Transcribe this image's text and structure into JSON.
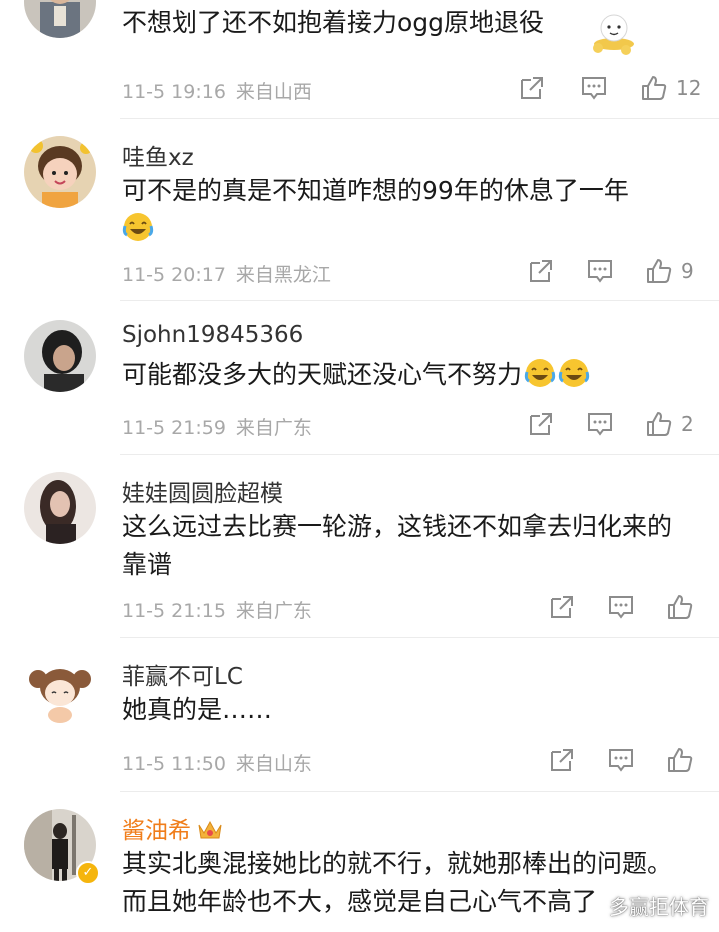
{
  "comments": [
    {
      "username": "",
      "text": "不想划了还不如抱着接力ogg原地退役",
      "time": "11-5 19:16",
      "location": "来自山西",
      "likes": "12",
      "avatar": "man-avatar"
    },
    {
      "username": "哇鱼xz",
      "text": "可不是的真是不知道咋想的99年的休息了一年",
      "time": "11-5 20:17",
      "location": "来自黑龙江",
      "likes": "9",
      "avatar": "cartoon-girl-avatar",
      "emojis": [
        "laughing-tears-emoji"
      ]
    },
    {
      "username": "Sjohn19845366",
      "text": "可能都没多大的天赋还没心气不努力",
      "time": "11-5 21:59",
      "location": "来自广东",
      "likes": "2",
      "avatar": "dark-photo-avatar",
      "emojis": [
        "laughing-tears-emoji",
        "laughing-tears-emoji"
      ]
    },
    {
      "username": "娃娃圆圆脸超模",
      "text": "这么远过去比赛一轮游，这钱还不如拿去归化来的靠谱",
      "time": "11-5 21:15",
      "location": "来自广东",
      "likes": "",
      "avatar": "girl-photo-avatar"
    },
    {
      "username": "菲赢不可LC",
      "text": "她真的是……",
      "time": "11-5 11:50",
      "location": "来自山东",
      "likes": "",
      "avatar": "chibi-girl-avatar"
    },
    {
      "username": "酱油希",
      "text": "其实北奥混接她比的就不行，就她那棒出的问题。而且她年龄也不大，感觉是自己心气不高了",
      "avatar": "street-photo-avatar",
      "vip": true,
      "verified": true
    }
  ],
  "watermark": "多赢拒体育",
  "colors": {
    "vip_name": "#f07d1a",
    "meta": "#a8a8a8",
    "divider": "#ececec"
  }
}
